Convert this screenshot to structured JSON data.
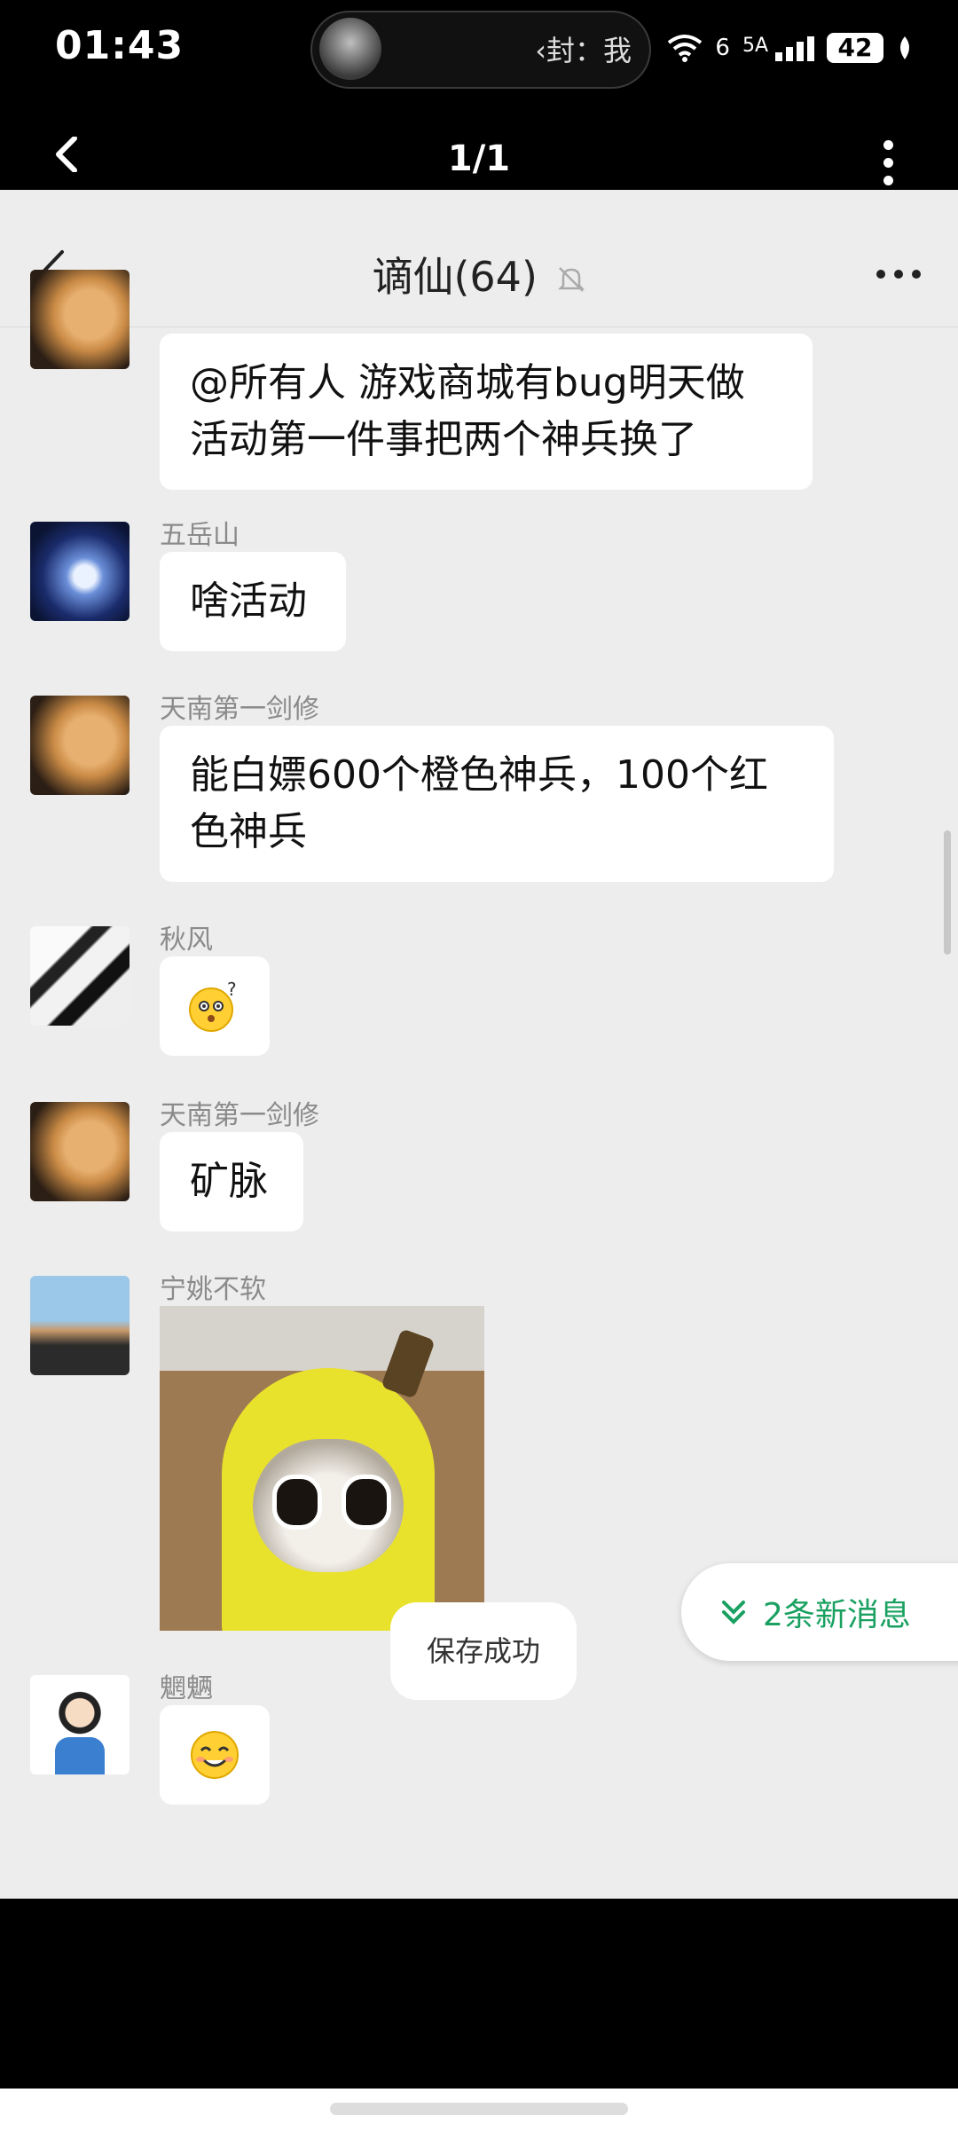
{
  "status_bar": {
    "time": "01:43",
    "notification_text": "‹封：我",
    "network_1": "6",
    "network_2": "5A",
    "battery": "42"
  },
  "viewer": {
    "page_indicator": "1/1"
  },
  "chat": {
    "title": "谪仙(64)",
    "messages": [
      {
        "sender": "",
        "text": "@所有人 游戏商城有bug明天做活动第一件事把两个神兵换了"
      },
      {
        "sender": "五岳山",
        "text": "啥活动"
      },
      {
        "sender": "天南第一剑修",
        "text": "能白嫖600个橙色神兵，100个红色神兵"
      },
      {
        "sender": "秋风",
        "emoji": "confused-face-emoji"
      },
      {
        "sender": "天南第一剑修",
        "text": "矿脉"
      },
      {
        "sender": "宁姚不软",
        "image": "banana-cat-sticker"
      },
      {
        "sender": "魍魉",
        "emoji": "smiling-face-emoji"
      }
    ]
  },
  "new_messages_button": "2条新消息",
  "toast": "保存成功",
  "colors": {
    "accent_green": "#1aa162",
    "chat_background": "#ededed",
    "bubble": "#ffffff"
  }
}
